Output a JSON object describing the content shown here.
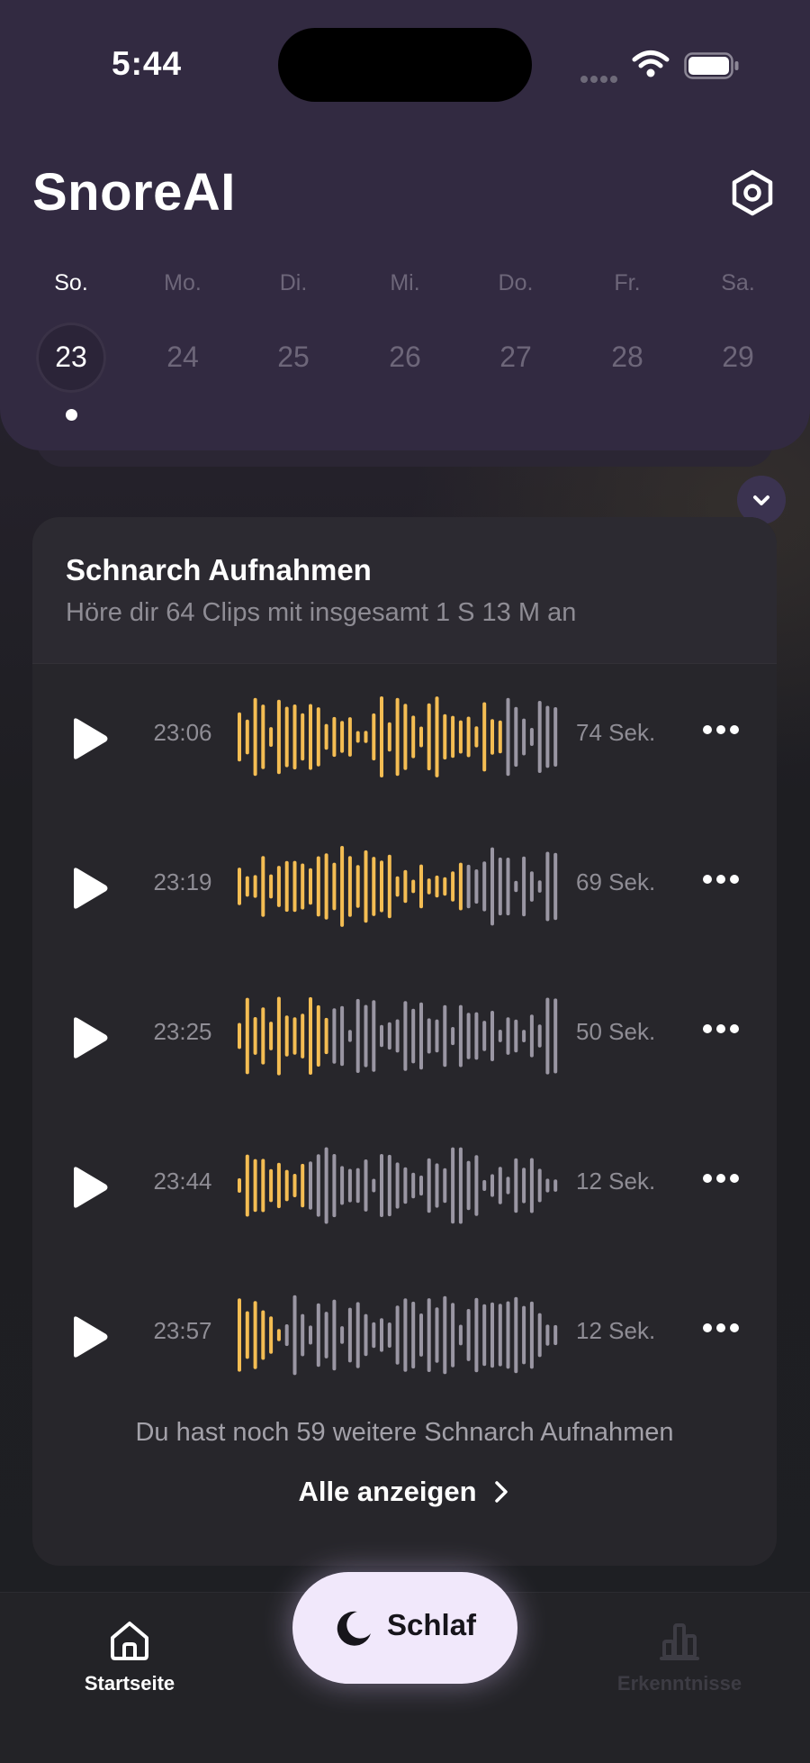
{
  "status_bar": {
    "time": "5:44"
  },
  "header": {
    "app_title": "SnoreAI",
    "week": [
      {
        "day": "So.",
        "date": "23",
        "active": true
      },
      {
        "day": "Mo.",
        "date": "24",
        "active": false
      },
      {
        "day": "Di.",
        "date": "25",
        "active": false
      },
      {
        "day": "Mi.",
        "date": "26",
        "active": false
      },
      {
        "day": "Do.",
        "date": "27",
        "active": false
      },
      {
        "day": "Fr.",
        "date": "28",
        "active": false
      },
      {
        "day": "Sa.",
        "date": "29",
        "active": false
      }
    ]
  },
  "recordings_card": {
    "title": "Schnarch Aufnahmen",
    "subtitle": "Höre dir 64 Clips mit insgesamt 1 S 13 M an",
    "recordings": [
      {
        "time": "23:06",
        "duration": "74 Sek.",
        "played_fraction": 0.83
      },
      {
        "time": "23:19",
        "duration": "69 Sek.",
        "played_fraction": 0.7
      },
      {
        "time": "23:25",
        "duration": "50 Sek.",
        "played_fraction": 0.29
      },
      {
        "time": "23:44",
        "duration": "12 Sek.",
        "played_fraction": 0.21
      },
      {
        "time": "23:57",
        "duration": "12 Sek.",
        "played_fraction": 0.13
      }
    ],
    "more_note": "Du hast noch 59 weitere Schnarch Aufnahmen",
    "show_all_label": "Alle anzeigen"
  },
  "tab_bar": {
    "home_label": "Startseite",
    "sleep_label": "Schlaf",
    "insights_label": "Erkenntnisse"
  },
  "colors": {
    "header_bg": "#322a41",
    "wave_played": "#f4bd53",
    "wave_unplayed": "#9a96a3",
    "sleep_button_bg": "#f1e8fb"
  },
  "icons": {
    "settings": "settings-hexagon-icon",
    "collapse": "chevron-down-icon",
    "play": "play-icon",
    "more": "more-dots-icon",
    "home": "home-icon",
    "sleep": "moon-icon",
    "insights": "bar-chart-icon"
  }
}
